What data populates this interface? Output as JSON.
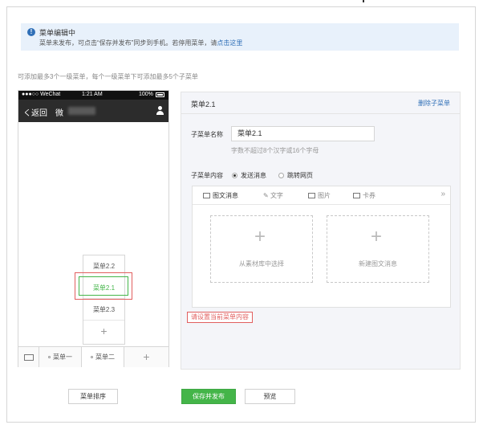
{
  "notice": {
    "title": "菜单编辑中",
    "desc_prefix": "菜单未发布，可点击“保存并发布”同步到手机。若停用菜单，请",
    "desc_link": "点击这里"
  },
  "hint": "可添加最多3个一级菜单，每个一级菜单下可添加最多5个子菜单",
  "phone": {
    "status": {
      "carrier": "●●●○○ WeChat",
      "time": "1:21 AM",
      "battery": "100%"
    },
    "nav": {
      "back": "く返回",
      "name": "微"
    },
    "submenu": [
      "菜单2.2",
      "菜单2.1",
      "菜单2.3",
      "+"
    ],
    "tabs": [
      "菜单一",
      "菜单二"
    ],
    "add": "+"
  },
  "editor": {
    "title": "菜单2.1",
    "delete_label": "删除子菜单",
    "name_label": "子菜单名称",
    "name_value": "菜单2.1",
    "name_tip": "字数不超过8个汉字或16个字母",
    "content_label": "子菜单内容",
    "radio_send": "发送消息",
    "radio_link": "跳转网页",
    "tabs": [
      "图文消息",
      "文字",
      "图片",
      "卡券"
    ],
    "more": "»",
    "slot_library": "从素材库中选择",
    "slot_new": "新建图文消息",
    "warning": "请设置当前菜单内容"
  },
  "buttons": {
    "sort": "菜单排序",
    "save": "保存并发布",
    "preview": "预览"
  }
}
